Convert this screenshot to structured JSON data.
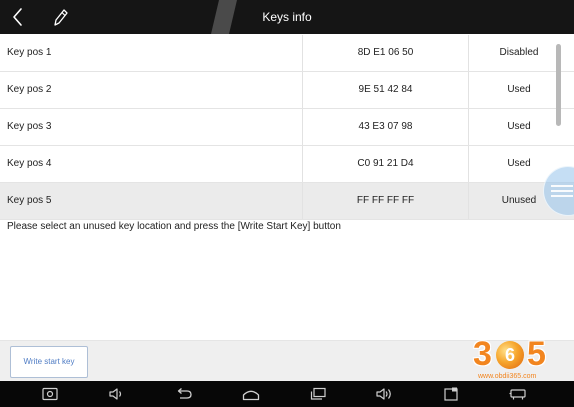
{
  "header": {
    "title": "Keys info",
    "back_icon": "back-arrow-icon",
    "edit_icon": "pencil-icon"
  },
  "keys": [
    {
      "label": "Key pos 1",
      "key_id": "8D E1 06 50",
      "status": "Disabled",
      "highlighted": false
    },
    {
      "label": "Key pos 2",
      "key_id": "9E 51 42 84",
      "status": "Used",
      "highlighted": false
    },
    {
      "label": "Key pos 3",
      "key_id": "43 E3 07 98",
      "status": "Used",
      "highlighted": false
    },
    {
      "label": "Key pos 4",
      "key_id": "C0 91 21 D4",
      "status": "Used",
      "highlighted": false
    },
    {
      "label": "Key pos 5",
      "key_id": "FF FF FF FF",
      "status": "Unused",
      "highlighted": true
    }
  ],
  "message": "Please select an unused key location and press the [Write Start Key] button",
  "actions": {
    "write_start_key": "Write start key"
  },
  "floating_button": {
    "icon": "assistive-menu-icon"
  },
  "nav_bar": {
    "icons": [
      "screenshot-icon",
      "volume-down-icon",
      "back-icon",
      "home-icon",
      "recents-icon",
      "volume-up-icon",
      "notes-icon",
      "cast-icon"
    ]
  },
  "watermark": {
    "logo_chars": [
      "3",
      "6",
      "5"
    ],
    "url": "www.obdii365.com"
  },
  "colors": {
    "header_bg": "#151515",
    "nav_bg": "#070707",
    "highlight_row": "#ebebeb",
    "button_text": "#4f7cc4",
    "watermark": "#f2851f"
  }
}
